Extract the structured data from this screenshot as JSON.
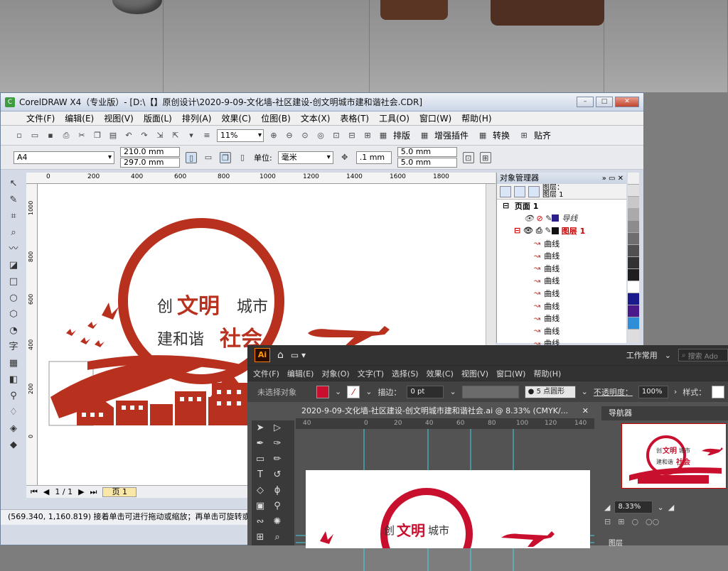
{
  "coreldraw": {
    "title": "CorelDRAW X4（专业版）- [D:\\【】原创设计\\2020-9-09-文化墙-社区建设-创文明城市建和谐社会.CDR]",
    "menu": [
      "文件(F)",
      "编辑(E)",
      "视图(V)",
      "版面(L)",
      "排列(A)",
      "效果(C)",
      "位图(B)",
      "文本(X)",
      "表格(T)",
      "工具(O)",
      "窗口(W)",
      "帮助(H)"
    ],
    "zoom": "11%",
    "toolbar_labels": [
      "排版",
      "增强插件",
      "转换",
      "贴齐"
    ],
    "paper": "A4",
    "width": "210.0 mm",
    "height": "297.0 mm",
    "unit_label": "单位:",
    "unit": "毫米",
    "nudge": ".1 mm",
    "dup_x": "5.0 mm",
    "dup_y": "5.0 mm",
    "ruler_h": [
      "0",
      "200",
      "400",
      "600",
      "800",
      "1000",
      "1200",
      "1400",
      "1600",
      "1800"
    ],
    "ruler_v": [
      "1000",
      "800",
      "600",
      "400",
      "200",
      "0"
    ],
    "page_counter": "1 / 1",
    "page_tab": "页 1",
    "status": "(569.340, 1,160.819) 接着单击可进行拖动或缩放；再单击可旋转或倾斜"
  },
  "object_manager": {
    "title": "对象管理器",
    "layer_label_a": "图层：",
    "layer_label_b": "图层 1",
    "page": "页面 1",
    "guides": "导线",
    "layer": "图层 1",
    "curves": [
      "曲线",
      "曲线",
      "曲线",
      "曲线",
      "曲线",
      "曲线",
      "曲线",
      "曲线",
      "曲线"
    ]
  },
  "artwork": {
    "line1_a": "创",
    "line1_b": "文明",
    "line1_c": "城市",
    "line2_a": "建和谐",
    "line2_b": "社会"
  },
  "illustrator": {
    "logo": "Ai",
    "workspace": "工作常用",
    "search_placeholder": "搜索 Ado",
    "menu": [
      "文件(F)",
      "编辑(E)",
      "对象(O)",
      "文字(T)",
      "选择(S)",
      "效果(C)",
      "视图(V)",
      "窗口(W)",
      "帮助(H)"
    ],
    "no_selection": "未选择对象",
    "stroke_label": "描边：",
    "stroke_value": "0 pt",
    "brush": "5 点圆形",
    "opacity_label": "不透明度：",
    "opacity": "100%",
    "style_label": "样式：",
    "doc_tab": "2020-9-09-文化墙-社区建设-创文明城市建和谐社会.ai @ 8.33% (CMYK/...",
    "ruler": [
      "40",
      "0",
      "20",
      "40",
      "60",
      "80",
      "100",
      "120",
      "140"
    ],
    "navigator": "导航器",
    "nav_zoom": "8.33%",
    "layers": "图层"
  },
  "colors": {
    "brand_red": "#b8311f",
    "ai_accent": "#ff9a00"
  }
}
